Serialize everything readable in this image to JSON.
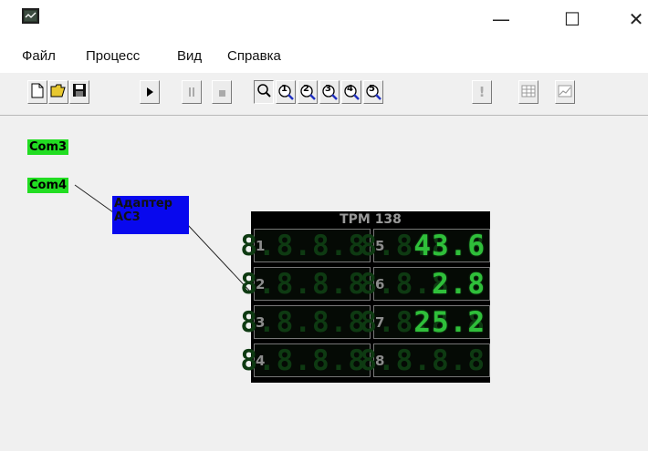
{
  "window": {
    "minimize_glyph": "—",
    "maximize_glyph": "☐",
    "close_glyph": "✕"
  },
  "menu": [
    "Файл",
    "Процесс",
    "Вид",
    "Справка"
  ],
  "toolbar": {
    "icons": [
      "new-file-icon",
      "open-folder-icon",
      "save-icon",
      "play-icon",
      "pause-icon",
      "stop-icon",
      "zoom-icon",
      "zoom-1-icon",
      "zoom-2-icon",
      "zoom-3-icon",
      "zoom-4-icon",
      "zoom-5-icon",
      "alert-icon",
      "table-icon",
      "chart-icon"
    ],
    "zoom_digits": [
      "1",
      "2",
      "3",
      "4",
      "5"
    ],
    "alert_label": "!"
  },
  "nodes": {
    "com3": "Com3",
    "com4": "Com4",
    "adapter_line1": "Адаптер",
    "adapter_line2": "АС3"
  },
  "device": {
    "title": "ТРМ 138",
    "channels": [
      {
        "num": "1",
        "value": ""
      },
      {
        "num": "2",
        "value": ""
      },
      {
        "num": "3",
        "value": ""
      },
      {
        "num": "4",
        "value": ""
      },
      {
        "num": "5",
        "value": "43.6"
      },
      {
        "num": "6",
        "value": "2.8"
      },
      {
        "num": "7",
        "value": "25.2"
      },
      {
        "num": "8",
        "value": ""
      }
    ]
  },
  "colors": {
    "com_green": "#22dd22",
    "adapter_blue": "#0808ee",
    "segment_green": "#2fbf3a"
  }
}
